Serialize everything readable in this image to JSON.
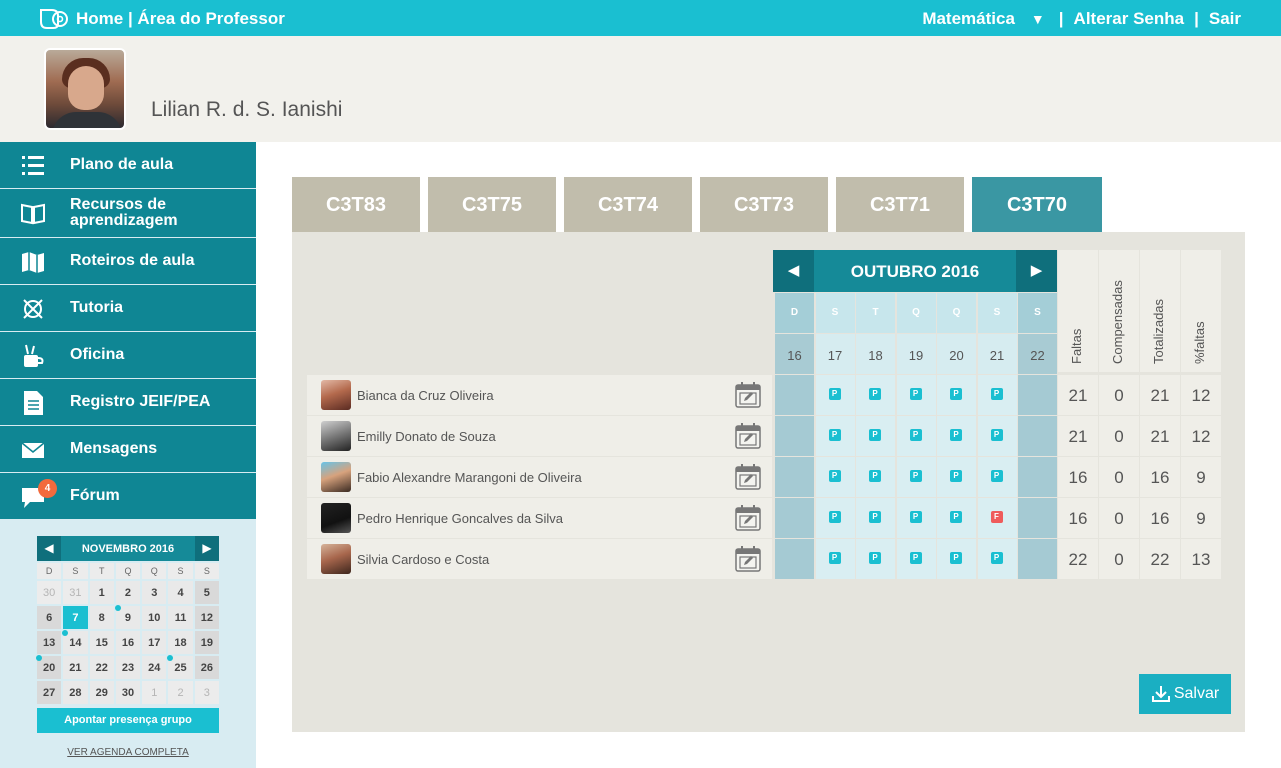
{
  "topbar": {
    "title": "Home | Área do Professor",
    "subject": "Matemática",
    "dropdown_icon": "triangle-down",
    "separator": "|",
    "change_password": "Alterar Senha",
    "separator2": "|",
    "logout": "Sair"
  },
  "profile": {
    "name": "Lilian R. d. S. Ianishi"
  },
  "sidebar": {
    "items": [
      {
        "label": "Plano de aula",
        "icon": "numbered-list-icon"
      },
      {
        "label": "Recursos de aprendizagem",
        "icon": "book-icon"
      },
      {
        "label": "Roteiros de aula",
        "icon": "map-icon"
      },
      {
        "label": "Tutoria",
        "icon": "compass-icon"
      },
      {
        "label": "Oficina",
        "icon": "tools-icon"
      },
      {
        "label": "Registro JEIF/PEA",
        "icon": "document-icon"
      },
      {
        "label": "Mensagens",
        "icon": "envelope-icon"
      },
      {
        "label": "Fórum",
        "icon": "chat-bubble-icon",
        "badge": "4"
      }
    ]
  },
  "mini_calendar": {
    "month": "NOVEMBRO 2016",
    "prev": "◀",
    "next": "▶",
    "weekdays": [
      "D",
      "S",
      "T",
      "Q",
      "Q",
      "S",
      "S"
    ],
    "weeks": [
      [
        "30",
        "31",
        "1",
        "2",
        "3",
        "4",
        "5"
      ],
      [
        "6",
        "7",
        "8",
        "9",
        "10",
        "11",
        "12"
      ],
      [
        "13",
        "14",
        "15",
        "16",
        "17",
        "18",
        "19"
      ],
      [
        "20",
        "21",
        "22",
        "23",
        "24",
        "25",
        "26"
      ],
      [
        "27",
        "28",
        "29",
        "30",
        "1",
        "2",
        "3"
      ]
    ],
    "group_button": "Apontar presença grupo",
    "agenda_link": "VER AGENDA COMPLETA"
  },
  "tabs": [
    "C3T83",
    "C3T75",
    "C3T74",
    "C3T73",
    "C3T71",
    "C3T70"
  ],
  "active_tab": "C3T70",
  "attendance": {
    "month": "OUTUBRO 2016",
    "prev": "◀",
    "next": "▶",
    "weekdays": [
      "D",
      "S",
      "T",
      "Q",
      "Q",
      "S",
      "S"
    ],
    "days": [
      "16",
      "17",
      "18",
      "19",
      "20",
      "21",
      "22"
    ],
    "stat_headers": [
      "Faltas",
      "Compensadas",
      "Totalizadas",
      "%faltas"
    ],
    "students": [
      {
        "name": "Bianca da Cruz Oliveira",
        "marks": [
          "",
          "P",
          "P",
          "P",
          "P",
          "P",
          ""
        ],
        "stats": [
          "21",
          "0",
          "21",
          "12"
        ]
      },
      {
        "name": "Emilly Donato de Souza",
        "marks": [
          "",
          "P",
          "P",
          "P",
          "P",
          "P",
          ""
        ],
        "stats": [
          "21",
          "0",
          "21",
          "12"
        ]
      },
      {
        "name": "Fabio Alexandre Marangoni de Oliveira",
        "marks": [
          "",
          "P",
          "P",
          "P",
          "P",
          "P",
          ""
        ],
        "stats": [
          "16",
          "0",
          "16",
          "9"
        ]
      },
      {
        "name": "Pedro Henrique Goncalves da Silva",
        "marks": [
          "",
          "P",
          "P",
          "P",
          "P",
          "F",
          ""
        ],
        "stats": [
          "16",
          "0",
          "16",
          "9"
        ]
      },
      {
        "name": "Silvia Cardoso e Costa",
        "marks": [
          "",
          "P",
          "P",
          "P",
          "P",
          "P",
          ""
        ],
        "stats": [
          "22",
          "0",
          "22",
          "13"
        ]
      }
    ]
  },
  "save_button": "Salvar",
  "colors": {
    "accent": "#1abfd1",
    "sidebar": "#0f8694",
    "tab_inactive": "#c1bdac",
    "tab_active": "#3a97a3",
    "absent": "#ef5b5b"
  }
}
